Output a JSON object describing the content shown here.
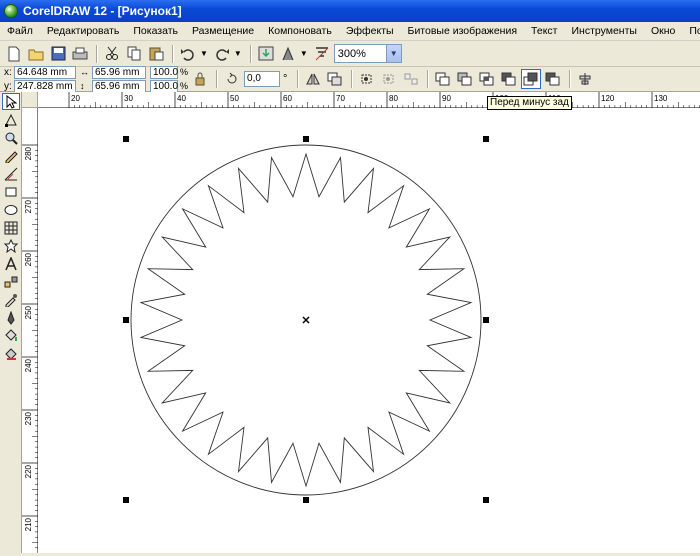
{
  "window": {
    "title": "CorelDRAW 12 - [Рисунок1]"
  },
  "menu": [
    "Файл",
    "Редактировать",
    "Показать",
    "Размещение",
    "Компоновать",
    "Эффекты",
    "Битовые изображения",
    "Текст",
    "Инструменты",
    "Окно",
    "Помощь"
  ],
  "toolbar": {
    "zoom_value": "300%",
    "icons": [
      "new-icon",
      "open-icon",
      "save-icon",
      "print-icon",
      "cut-icon",
      "copy-icon",
      "paste-icon",
      "undo-icon",
      "redo-icon",
      "import-icon",
      "export-icon",
      "app-launcher-icon",
      "corel-online-icon"
    ]
  },
  "property_bar": {
    "x_label": "x:",
    "x_value": "64.648 mm",
    "y_label": "y:",
    "y_value": "247.828 mm",
    "width_value": "65.96 mm",
    "height_value": "65.96 mm",
    "scale_x": "100.0",
    "scale_y": "100.0",
    "percent": "%",
    "rotation_value": "0,0",
    "degree": "°"
  },
  "tooltip": "Перед минус зад",
  "ruler": {
    "h_ticks": [
      "20",
      "30",
      "40",
      "50",
      "60",
      "70",
      "80",
      "90",
      "100",
      "110",
      "120",
      "130"
    ],
    "v_ticks": [
      "280",
      "270",
      "260",
      "250",
      "240",
      "230",
      "220",
      "210"
    ]
  },
  "tools": [
    "pick-tool-icon",
    "shape-tool-icon",
    "zoom-tool-icon",
    "freehand-tool-icon",
    "smart-fill-icon",
    "rectangle-tool-icon",
    "ellipse-tool-icon",
    "graph-paper-icon",
    "star-tool-icon",
    "text-tool-icon",
    "interactive-blend-icon",
    "eyedropper-icon",
    "outline-pen-icon",
    "fill-bucket-icon",
    "interactive-fill-icon"
  ],
  "drawing": {
    "outer_circle_stroke": "#333333",
    "star_points": 30
  }
}
